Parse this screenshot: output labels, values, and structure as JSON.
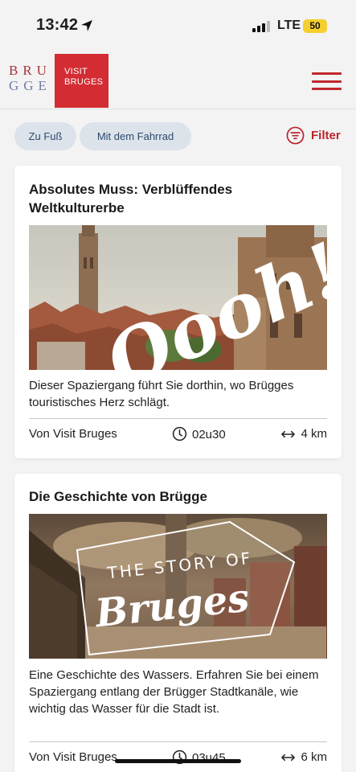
{
  "status_bar": {
    "time": "13:42",
    "network": "LTE",
    "battery": "50",
    "battery_color": "#f5cf2d"
  },
  "header": {
    "logo_brugge_line1": "BRU",
    "logo_brugge_line2": "GGE",
    "logo_visit_line1": "VISIT",
    "logo_visit_line2": "BRUGES",
    "menu_icon": "hamburger-icon",
    "brand_red": "#d42c33"
  },
  "filters": {
    "chips": [
      {
        "label": "Zu Fuß"
      },
      {
        "label": "Mit dem Fahrrad"
      }
    ],
    "filter_label": "Filter",
    "filter_icon": "filter-icon",
    "accent": "#b8242c"
  },
  "routes": [
    {
      "title": "Absolutes Muss: Verblüffendes Weltkulturerbe",
      "image_overlay_text": "Oooh!",
      "image_alt_icon": "belfry-cityscape-image",
      "description": "Dieser Spaziergang führt Sie dorthin, wo Brügges touristisches Herz schlägt.",
      "author": "Von Visit Bruges",
      "duration": "02u30",
      "distance": "4 km"
    },
    {
      "title": "Die Geschichte von Brügge",
      "image_overlay_line1": "THE STORY OF",
      "image_overlay_line2": "Bruges",
      "image_alt_icon": "historic-painting-image",
      "description": "Eine Geschichte des Wassers. Erfahren Sie bei einem Spaziergang entlang der Brügger Stadtkanäle, wie wichtig das Wasser für die Stadt ist.",
      "author": "Von Visit Bruges",
      "duration": "03u45",
      "distance": "6 km"
    }
  ]
}
